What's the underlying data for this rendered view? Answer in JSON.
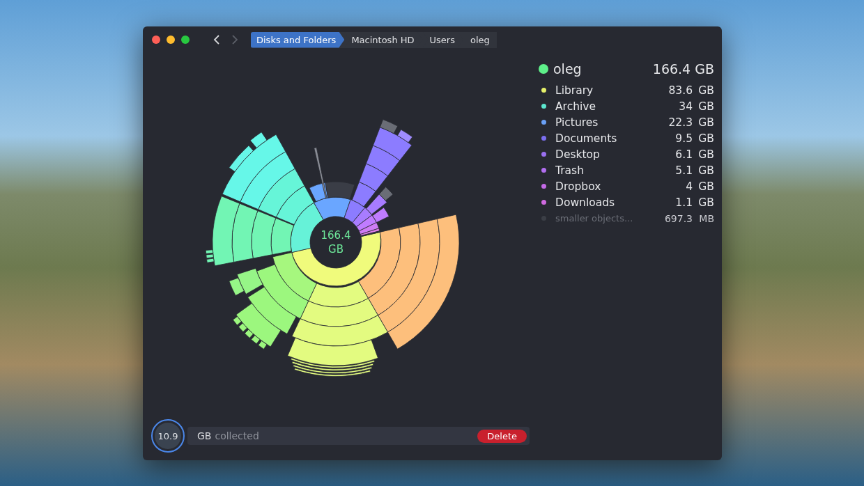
{
  "navigation": {
    "back_disabled": false,
    "forward_disabled": true
  },
  "breadcrumb": [
    {
      "label": "Disks and Folders",
      "selected": true
    },
    {
      "label": "Macintosh HD",
      "selected": false
    },
    {
      "label": "Users",
      "selected": false
    },
    {
      "label": "oleg",
      "selected": false
    }
  ],
  "chart_center": "166.4 GB",
  "summary": {
    "name": "oleg",
    "size": "166.4 GB",
    "color": "#5ef08a"
  },
  "legend": [
    {
      "name": "Library",
      "size": "83.6",
      "unit": "GB",
      "color": "#e6f06a",
      "dimmed": false
    },
    {
      "name": "Archive",
      "size": "34",
      "unit": "GB",
      "color": "#5ce6cf",
      "dimmed": false
    },
    {
      "name": "Pictures",
      "size": "22.3",
      "unit": "GB",
      "color": "#6aa0f5",
      "dimmed": false
    },
    {
      "name": "Documents",
      "size": "9.5",
      "unit": "GB",
      "color": "#7b6ff0",
      "dimmed": false
    },
    {
      "name": "Desktop",
      "size": "6.1",
      "unit": "GB",
      "color": "#9a70f0",
      "dimmed": false
    },
    {
      "name": "Trash",
      "size": "5.1",
      "unit": "GB",
      "color": "#b16ef0",
      "dimmed": false
    },
    {
      "name": "Dropbox",
      "size": "4",
      "unit": "GB",
      "color": "#c46ae8",
      "dimmed": false
    },
    {
      "name": "Downloads",
      "size": "1.1",
      "unit": "GB",
      "color": "#d06ae0",
      "dimmed": false
    },
    {
      "name": "smaller objects...",
      "size": "697.3",
      "unit": "MB",
      "color": "#3b3e46",
      "dimmed": true
    }
  ],
  "collector": {
    "amount": "10.9",
    "unit": "GB",
    "label": "collected",
    "button": "Delete"
  }
}
